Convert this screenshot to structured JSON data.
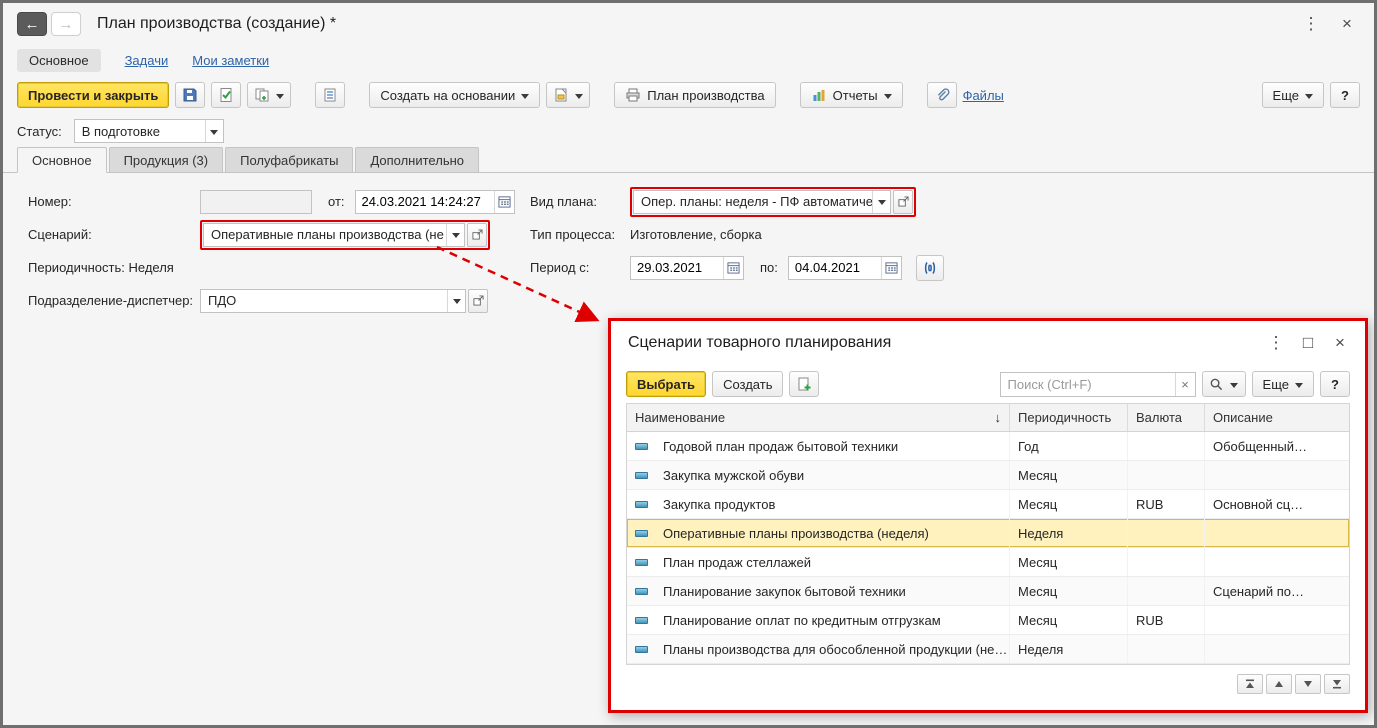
{
  "titlebar": {
    "back": "←",
    "forward": "→",
    "title": "План производства (создание) *",
    "menu": "⋮",
    "close": "×"
  },
  "nav": {
    "main": "Основное",
    "tasks": "Задачи",
    "notes": "Мои заметки"
  },
  "toolbar": {
    "post_and_close": "Провести и закрыть",
    "create_based_on": "Создать на основании",
    "production_plan": "План производства",
    "reports": "Отчеты",
    "files": "Файлы",
    "more": "Еще",
    "help": "?"
  },
  "status": {
    "label": "Статус:",
    "value": "В подготовке"
  },
  "tabs": {
    "main": "Основное",
    "products": "Продукция (3)",
    "semi": "Полуфабрикаты",
    "extra": "Дополнительно"
  },
  "form": {
    "number_label": "Номер:",
    "number_value": "",
    "from_label": "от:",
    "datetime": "24.03.2021 14:24:27",
    "plan_kind_label": "Вид плана:",
    "plan_kind_value": "Опер. планы: неделя - ПФ автоматиче",
    "scenario_label": "Сценарий:",
    "scenario_value": "Оперативные планы производства (не",
    "process_label": "Тип процесса:",
    "process_value": "Изготовление, сборка",
    "periodicity": "Периодичность: Неделя",
    "period_from_label": "Период с:",
    "period_from": "29.03.2021",
    "period_to_label": "по:",
    "period_to": "04.04.2021",
    "dispatcher_label": "Подразделение-диспетчер:",
    "dispatcher_value": "ПДО"
  },
  "dialog": {
    "title": "Сценарии товарного планирования",
    "menu": "⋮",
    "maximize": "□",
    "close": "×",
    "select": "Выбрать",
    "create": "Создать",
    "search_placeholder": "Поиск (Ctrl+F)",
    "clear": "×",
    "more": "Еще",
    "help": "?",
    "sort": "↓",
    "columns": {
      "name": "Наименование",
      "period": "Периодичность",
      "currency": "Валюта",
      "description": "Описание"
    },
    "rows": [
      {
        "name": "Годовой план продаж бытовой техники",
        "period": "Год",
        "currency": "",
        "description": "Обобщенный…"
      },
      {
        "name": "Закупка мужской обуви",
        "period": "Месяц",
        "currency": "",
        "description": ""
      },
      {
        "name": "Закупка продуктов",
        "period": "Месяц",
        "currency": "RUB",
        "description": "Основной сц…"
      },
      {
        "name": "Оперативные планы производства (неделя)",
        "period": "Неделя",
        "currency": "",
        "description": ""
      },
      {
        "name": "План продаж стеллажей",
        "period": "Месяц",
        "currency": "",
        "description": ""
      },
      {
        "name": "Планирование закупок бытовой техники",
        "period": "Месяц",
        "currency": "",
        "description": "Сценарий по…"
      },
      {
        "name": "Планирование оплат по кредитным отгрузкам",
        "period": "Месяц",
        "currency": "RUB",
        "description": ""
      },
      {
        "name": "Планы производства для обособленной продукции (не…",
        "period": "Неделя",
        "currency": "",
        "description": ""
      }
    ]
  },
  "colors": {
    "accent_yellow": "#FFD62E",
    "annotation_red": "#DE0000",
    "link_blue": "#2E64A8",
    "selected_row": "#FFF2BE"
  }
}
